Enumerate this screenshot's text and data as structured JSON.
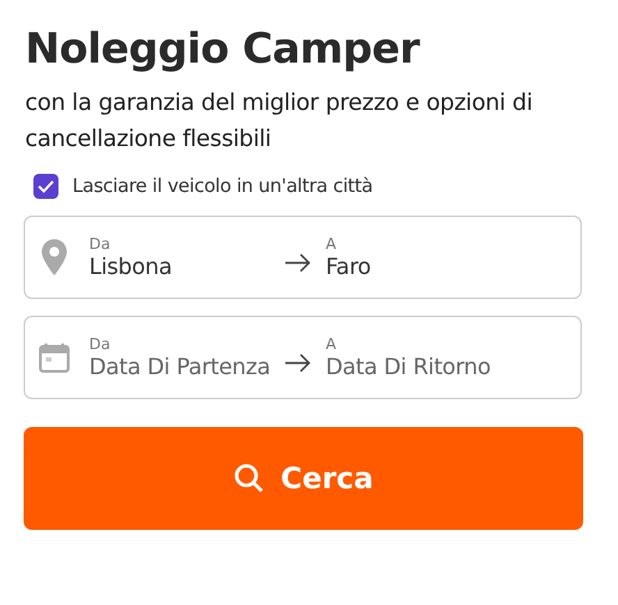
{
  "title": "Noleggio Camper",
  "subtitle": "con la garanzia del miglior prezzo e opzioni di cancellazione flessibili",
  "option": {
    "label": "Lasciare il veicolo in un'altra città",
    "checked": true
  },
  "fields": [
    {
      "kind": "location",
      "from": {
        "label": "Da",
        "value": "Lisbona"
      },
      "to": {
        "label": "A",
        "value": "Faro"
      }
    },
    {
      "kind": "date",
      "from": {
        "label": "Da",
        "placeholder": "Data Di Partenza"
      },
      "to": {
        "label": "A",
        "placeholder": "Data Di Ritorno"
      }
    }
  ],
  "button": {
    "label": "Cerca"
  }
}
